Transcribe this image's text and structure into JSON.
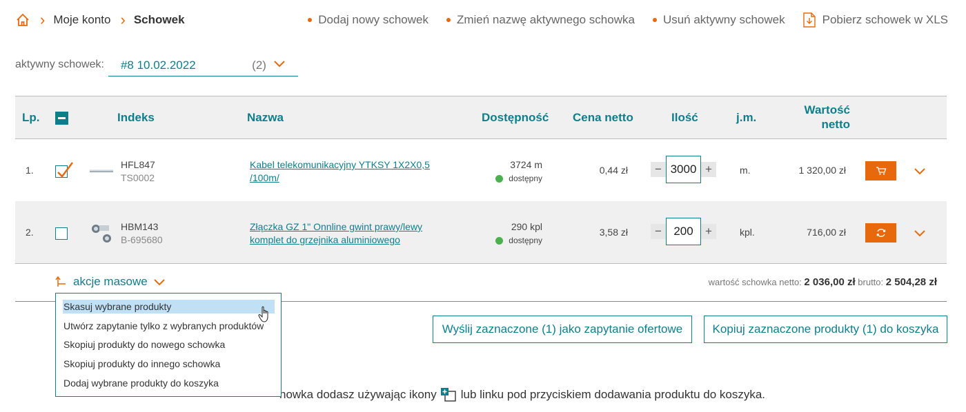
{
  "breadcrumb": {
    "items": [
      "Moje konto",
      "Schowek"
    ]
  },
  "actions": {
    "add": "Dodaj nowy schowek",
    "rename": "Zmień nazwę aktywnego schowka",
    "delete": "Usuń aktywny schowek",
    "download": "Pobierz schowek w XLS"
  },
  "active": {
    "label": "aktywny schowek:",
    "value": "#8 10.02.2022",
    "count": "(2)"
  },
  "table": {
    "headers": {
      "lp": "Lp.",
      "index": "Indeks",
      "name": "Nazwa",
      "availability": "Dostępność",
      "price": "Cena netto",
      "qty": "Ilość",
      "unit": "j.m.",
      "value_line1": "Wartość",
      "value_line2": "netto"
    },
    "rows": [
      {
        "lp": "1.",
        "checked": true,
        "index": "HFL847",
        "code": "TS0002",
        "name_line1": "Kabel telekomunikacyjny YTKSY 1X2X0,5",
        "name_line2": "/100m/",
        "stock": "3724 m",
        "status": "dostępny",
        "price": "0,44 zł",
        "qty": "3000",
        "unit": "m.",
        "value": "1 320,00 zł",
        "action_icon": "cart-icon"
      },
      {
        "lp": "2.",
        "checked": false,
        "index": "HBM143",
        "code": "B-695680",
        "name_line1": "Złączka GZ 1\" Onnline gwint prawy/lewy",
        "name_line2": "komplet do grzejnika aluminiowego",
        "stock": "290 kpl",
        "status": "dostępny",
        "price": "3,58 zł",
        "qty": "200",
        "unit": "kpl.",
        "value": "716,00 zł",
        "action_icon": "refresh-icon"
      }
    ]
  },
  "mass": {
    "label": "akcje masowe"
  },
  "totals": {
    "net_label": "wartość schowka netto:",
    "net": "2 036,00 zł",
    "gross_label": "brutto:",
    "gross": "2 504,28 zł"
  },
  "menu": {
    "items": [
      "Skasuj wybrane produkty",
      "Utwórz zapytanie tylko z wybranych produktów",
      "Skopiuj produkty do nowego schowka",
      "Skopiuj produkty do innego schowka",
      "Dodaj wybrane produkty do koszyka"
    ]
  },
  "buttons": {
    "send_query": "Wyślij zaznaczone (1) jako zapytanie ofertowe",
    "copy_cart": "Kopiuj zaznaczone produkty (1) do koszyka"
  },
  "info": {
    "before": "howka dodasz używając ikony",
    "after": "lub linku pod przyciskiem dodawania produktu do koszyka."
  },
  "colors": {
    "accent": "#0d7f8b",
    "orange": "#e8690b",
    "available": "#4caf50",
    "highlight": "#bfe0f5"
  }
}
